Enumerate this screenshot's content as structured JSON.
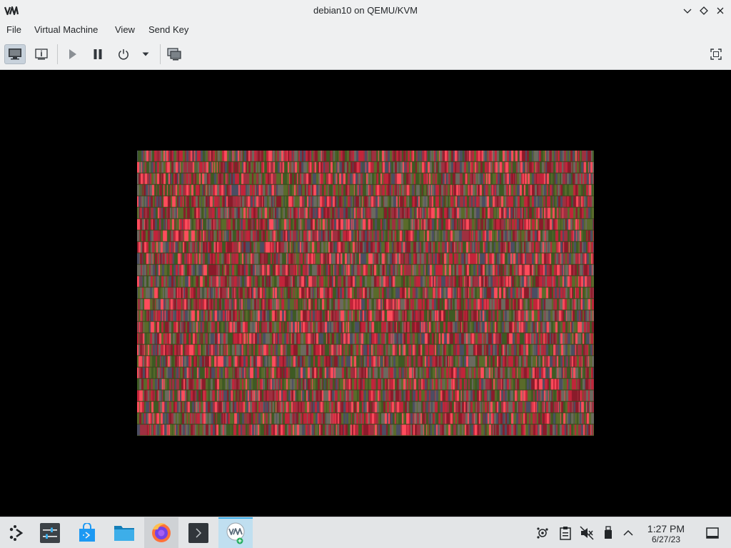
{
  "window": {
    "title": "debian10 on QEMU/KVM",
    "logo_text": "VM"
  },
  "menu": {
    "items": [
      "File",
      "Virtual Machine",
      "View",
      "Send Key"
    ]
  },
  "toolbar": {
    "icons": [
      "monitor-icon",
      "info-icon",
      "play-icon",
      "pause-icon",
      "power-icon",
      "dropdown-arrow-icon",
      "snapshots-icon",
      "fullscreen-icon"
    ]
  },
  "guest_display": {
    "description": "noise",
    "colors": [
      "#5a6b2a",
      "#6b6a5f",
      "#8a1b2a",
      "#c2243a",
      "#ff4c5c",
      "#4b4e63",
      "#3e5a23",
      "#9e3040"
    ]
  },
  "taskbar": {
    "apps": [
      "application-launcher-icon",
      "system-settings-icon",
      "discover-store-icon",
      "file-manager-icon",
      "firefox-icon",
      "konsole-icon",
      "virt-manager-icon"
    ]
  },
  "tray": {
    "icons": [
      "network-icon",
      "clipboard-icon",
      "volume-muted-icon",
      "usb-device-icon",
      "expand-tray-icon",
      "show-desktop-icon"
    ],
    "time": "1:27 PM",
    "date": "6/27/23"
  },
  "colors": {
    "chrome": "#eff0f1",
    "taskbar": "#e3e5e7",
    "accent": "#3daee9"
  }
}
